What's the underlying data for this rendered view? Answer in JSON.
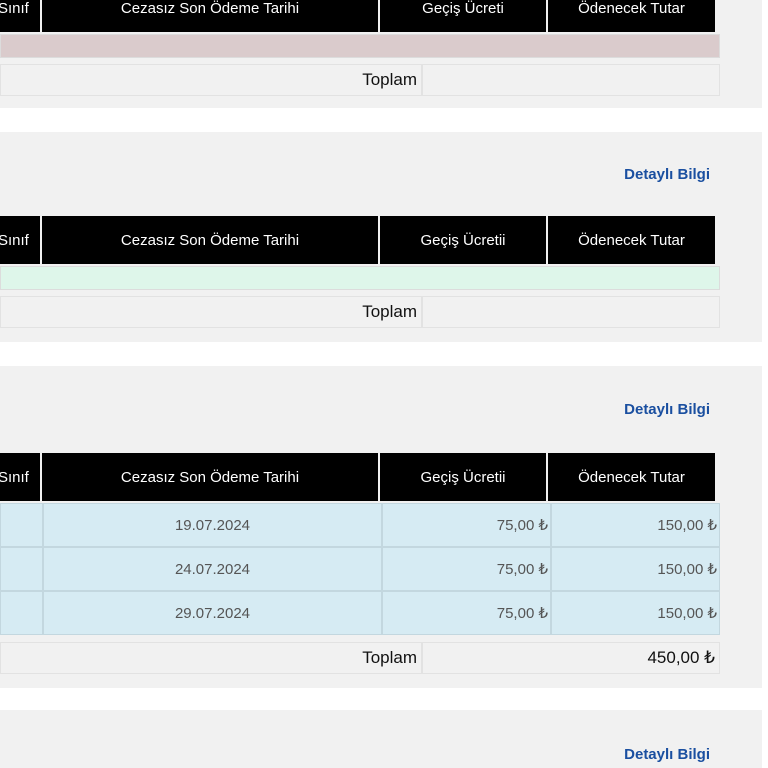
{
  "table_headers": {
    "sinif": "Sınıf",
    "last_date": "Cezasız Son Ödeme Tarihi",
    "fee_1": "Geçiş Ücreti",
    "fee_2": "Geçiş Ücretii",
    "amount": "Ödenecek Tutar"
  },
  "total_label": "Toplam",
  "detail_link": "Detaylı Bilgi",
  "colors": {
    "header_bg": "#000000",
    "panel_bg": "#f1f1f1",
    "link": "#1a4fa0",
    "band_pink": "#dacbcc",
    "band_green": "#def6ea",
    "row_blue": "#d6ebf3"
  },
  "section_3": {
    "rows": [
      {
        "date": "19.07.2024",
        "fee": "75,00 ₺",
        "amount": "150,00 ₺"
      },
      {
        "date": "24.07.2024",
        "fee": "75,00 ₺",
        "amount": "150,00 ₺"
      },
      {
        "date": "29.07.2024",
        "fee": "75,00 ₺",
        "amount": "150,00 ₺"
      }
    ],
    "total": "450,00 ₺"
  }
}
